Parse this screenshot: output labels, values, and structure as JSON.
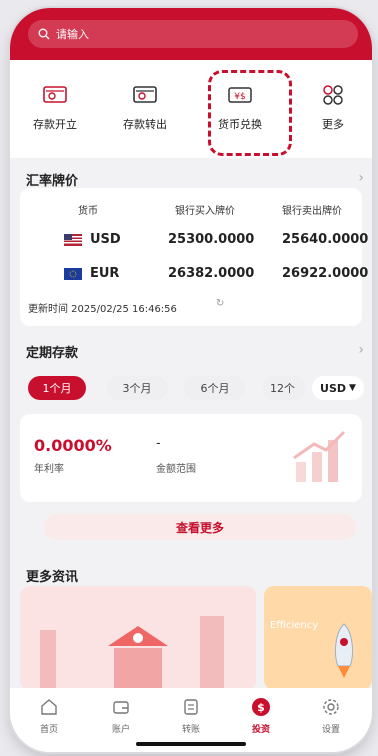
{
  "search": {
    "placeholder": "请输入"
  },
  "quick": [
    {
      "label": "存款开立",
      "icon": "deposit-open-icon"
    },
    {
      "label": "存款转出",
      "icon": "deposit-transfer-icon"
    },
    {
      "label": "货币兑换",
      "icon": "currency-exchange-icon"
    },
    {
      "label": "更多",
      "icon": "grid-icon"
    }
  ],
  "rates": {
    "title": "汇率牌价",
    "headers": [
      "货币",
      "银行买入牌价",
      "银行卖出牌价"
    ],
    "rows": [
      {
        "code": "USD",
        "buy": "25300.0000",
        "sell": "25640.0000"
      },
      {
        "code": "EUR",
        "buy": "26382.0000",
        "sell": "26922.0000"
      }
    ],
    "updated": "更新时间 2025/02/25 16:46:56"
  },
  "fixed": {
    "title": "定期存款",
    "tabs": [
      "1个月",
      "3个月",
      "6个月",
      "12个"
    ],
    "currency": "USD",
    "rate": "0.0000%",
    "rate_label": "年利率",
    "amount": "-",
    "amount_label": "金额范围",
    "more": "查看更多"
  },
  "news": {
    "title": "更多资讯",
    "card2": "Efficiency"
  },
  "tabbar": [
    {
      "label": "首页",
      "icon": "home-icon"
    },
    {
      "label": "账户",
      "icon": "wallet-icon"
    },
    {
      "label": "转账",
      "icon": "transfer-icon"
    },
    {
      "label": "投资",
      "icon": "invest-icon"
    },
    {
      "label": "设置",
      "icon": "settings-icon"
    }
  ],
  "colors": {
    "accent": "#c8102e"
  }
}
